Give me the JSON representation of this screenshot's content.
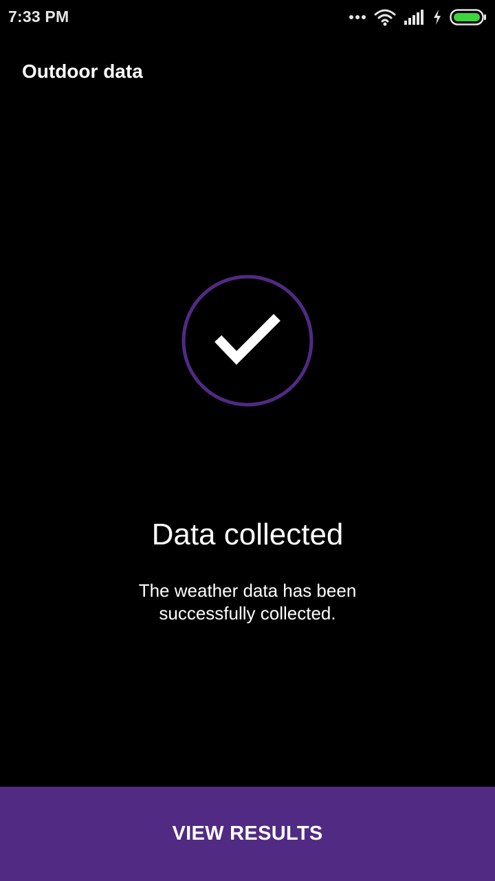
{
  "status_bar": {
    "time": "7:33 PM",
    "icons": [
      "more-dots-icon",
      "wifi-icon",
      "signal-icon",
      "charging-icon",
      "battery-icon"
    ],
    "battery_color": "#3dd43d"
  },
  "app_bar": {
    "title": "Outdoor data"
  },
  "success": {
    "icon": "check-circle-icon",
    "ring_color": "#512a84",
    "headline": "Data collected",
    "message": "The weather data has been successfully collected."
  },
  "bottom_action": {
    "label": "VIEW RESULTS",
    "background": "#512a84"
  }
}
